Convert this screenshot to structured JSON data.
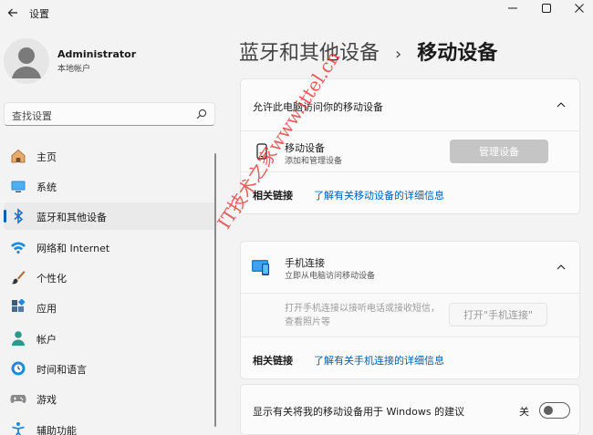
{
  "window": {
    "title": "设置",
    "back_icon": "arrow-left-icon",
    "minimize_icon": "minimize-icon",
    "maximize_icon": "maximize-icon",
    "close_icon": "close-icon"
  },
  "user": {
    "name": "Administrator",
    "account_type": "本地帐户"
  },
  "search": {
    "placeholder": "查找设置"
  },
  "nav": {
    "items": [
      {
        "label": "主页",
        "icon": "home-icon"
      },
      {
        "label": "系统",
        "icon": "monitor-icon"
      },
      {
        "label": "蓝牙和其他设备",
        "icon": "bluetooth-icon"
      },
      {
        "label": "网络和 Internet",
        "icon": "wifi-icon"
      },
      {
        "label": "个性化",
        "icon": "brush-icon"
      },
      {
        "label": "应用",
        "icon": "apps-icon"
      },
      {
        "label": "帐户",
        "icon": "person-icon"
      },
      {
        "label": "时间和语言",
        "icon": "globe-clock-icon"
      },
      {
        "label": "游戏",
        "icon": "gamepad-icon"
      },
      {
        "label": "辅助功能",
        "icon": "accessibility-icon"
      }
    ],
    "active_index": 2
  },
  "breadcrumb": {
    "parent": "蓝牙和其他设备",
    "separator": "›",
    "current": "移动设备"
  },
  "section_mobile": {
    "header": "允许此电脑访问你的移动设备",
    "device_title": "移动设备",
    "device_sub": "添加和管理设备",
    "manage_button": "管理设备",
    "related_label": "相关链接",
    "related_link": "了解有关移动设备的详细信息"
  },
  "section_phone_link": {
    "title": "手机连接",
    "subtitle": "立即从电脑访问移动设备",
    "description": "打开手机连接以接听电话或接收短信，查看照片等",
    "open_button": "打开\"手机连接\"",
    "related_label": "相关链接",
    "related_link": "了解有关手机连接的详细信息"
  },
  "suggestions": {
    "label": "显示有关将我的移动设备用于 Windows 的建议",
    "toggle_state": "关"
  },
  "watermark": "IT技术之家www.ittel.cn",
  "colors": {
    "accent": "#005fb8",
    "background": "#f3f3f3",
    "card": "#fbfbfb",
    "watermark": "#e62828"
  }
}
